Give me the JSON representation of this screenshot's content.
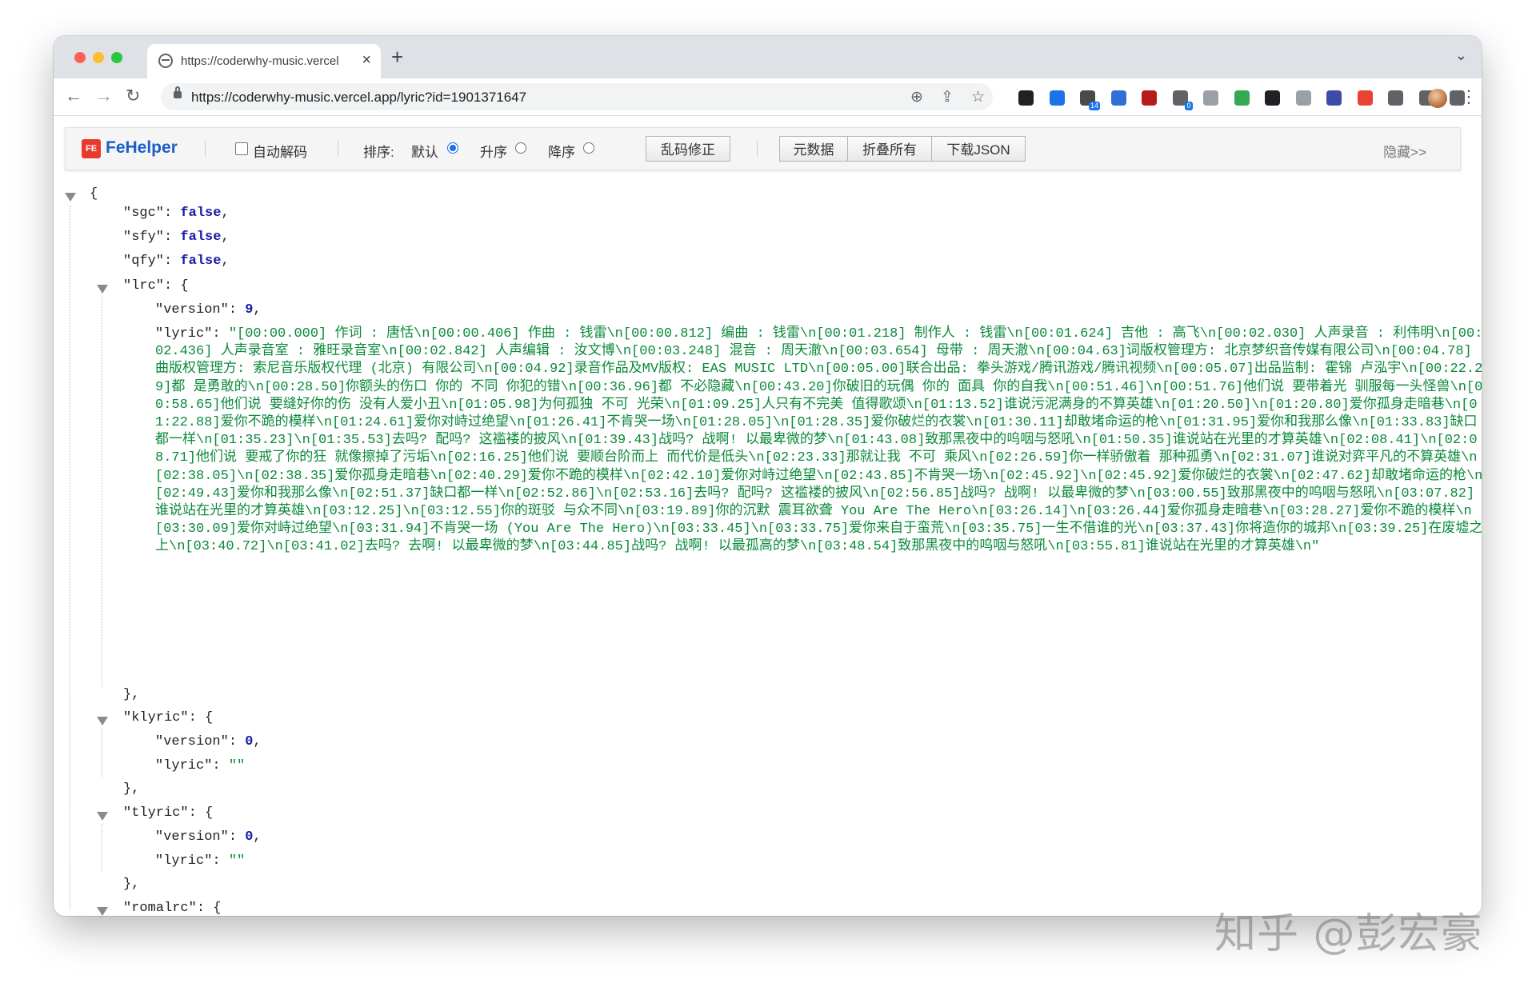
{
  "tab": {
    "title": "https://coderwhy-music.vercel",
    "close": "×",
    "new": "+",
    "menu": "⌄"
  },
  "toolbar": {
    "back": "←",
    "forward": "→",
    "reload": "↻",
    "url": "https://coderwhy-music.vercel.app/lyric?id=1901371647",
    "zoom_icon": "⊕",
    "share_icon": "⇪",
    "star_icon": "☆",
    "kebab": "⋮"
  },
  "extensions": [
    {
      "name": "ext-1",
      "color": "#202124",
      "badge": ""
    },
    {
      "name": "ext-2",
      "color": "#1a73e8",
      "badge": ""
    },
    {
      "name": "ext-3",
      "color": "#4a4a4a",
      "badge": "14"
    },
    {
      "name": "ext-4",
      "color": "#2f6fd6",
      "badge": ""
    },
    {
      "name": "ext-5",
      "color": "#b71c1c",
      "badge": ""
    },
    {
      "name": "ext-6",
      "color": "#5f6368",
      "badge": "0"
    },
    {
      "name": "ext-7",
      "color": "#9aa0a6",
      "badge": ""
    },
    {
      "name": "ext-8",
      "color": "#34a853",
      "badge": ""
    },
    {
      "name": "ext-9",
      "color": "#202124",
      "badge": ""
    },
    {
      "name": "ext-10",
      "color": "#9aa0a6",
      "badge": ""
    },
    {
      "name": "ext-11",
      "color": "#3c4aa8",
      "badge": ""
    },
    {
      "name": "ext-12",
      "color": "#ea4335",
      "badge": ""
    },
    {
      "name": "ext-13",
      "color": "#5f6368",
      "badge": ""
    },
    {
      "name": "ext-14",
      "color": "#5f6368",
      "badge": ""
    },
    {
      "name": "ext-15",
      "color": "#5f6368",
      "badge": ""
    }
  ],
  "fehelper": {
    "logo_badge": "FE",
    "logo_text": "FeHelper",
    "auto_decode": "自动解码",
    "sort_label": "排序:",
    "sort_default": "默认",
    "sort_asc": "升序",
    "sort_desc": "降序",
    "fix_garbled": "乱码修正",
    "metadata": "元数据",
    "collapse_all": "折叠所有",
    "download_json": "下载JSON",
    "hide": "隐藏>>"
  },
  "json": {
    "open_brace": "{",
    "sgc_key": "\"sgc\": ",
    "sgc_val": "false",
    "sfy_key": "\"sfy\": ",
    "sfy_val": "false",
    "qfy_key": "\"qfy\": ",
    "qfy_val": "false",
    "comma": ",",
    "lrc_key": "\"lrc\": {",
    "lrc_version_key": "\"version\": ",
    "lrc_version_val": "9",
    "lrc_lyric_key": "\"lyric\": ",
    "lrc_lyric_val": "\"[00:00.000] 作词 : 唐恬\\n[00:00.406] 作曲 : 钱雷\\n[00:00.812] 编曲 : 钱雷\\n[00:01.218] 制作人 : 钱雷\\n[00:01.624] 吉他 : 高飞\\n[00:02.030] 人声录音 : 利伟明\\n[00:02.436] 人声录音室 : 雅旺录音室\\n[00:02.842] 人声编辑 : 汝文博\\n[00:03.248] 混音 : 周天澈\\n[00:03.654] 母带 : 周天澈\\n[00:04.63]词版权管理方: 北京梦织音传媒有限公司\\n[00:04.78]曲版权管理方: 索尼音乐版权代理 (北京) 有限公司\\n[00:04.92]录音作品及MV版权: EAS MUSIC LTD\\n[00:05.00]联合出品: 拳头游戏/腾讯游戏/腾讯视频\\n[00:05.07]出品监制: 霍锦 卢泓宇\\n[00:22.29]都 是勇敢的\\n[00:28.50]你额头的伤口 你的 不同 你犯的错\\n[00:36.96]都 不必隐藏\\n[00:43.20]你破旧的玩偶 你的 面具 你的自我\\n[00:51.46]\\n[00:51.76]他们说 要带着光 驯服每一头怪兽\\n[00:58.65]他们说 要缝好你的伤 没有人爱小丑\\n[01:05.98]为何孤独 不可 光荣\\n[01:09.25]人只有不完美 值得歌颂\\n[01:13.52]谁说污泥满身的不算英雄\\n[01:20.50]\\n[01:20.80]爱你孤身走暗巷\\n[01:22.88]爱你不跪的模样\\n[01:24.61]爱你对峙过绝望\\n[01:26.41]不肯哭一场\\n[01:28.05]\\n[01:28.35]爱你破烂的衣裳\\n[01:30.11]却敢堵命运的枪\\n[01:31.95]爱你和我那么像\\n[01:33.83]缺口都一样\\n[01:35.23]\\n[01:35.53]去吗? 配吗? 这褴褛的披风\\n[01:39.43]战吗? 战啊! 以最卑微的梦\\n[01:43.08]致那黑夜中的呜咽与怒吼\\n[01:50.35]谁说站在光里的才算英雄\\n[02:08.41]\\n[02:08.71]他们说 要戒了你的狂 就像擦掉了污垢\\n[02:16.25]他们说 要顺台阶而上 而代价是低头\\n[02:23.33]那就让我 不可 乘风\\n[02:26.59]你一样骄傲着 那种孤勇\\n[02:31.07]谁说对弈平凡的不算英雄\\n[02:38.05]\\n[02:38.35]爱你孤身走暗巷\\n[02:40.29]爱你不跪的模样\\n[02:42.10]爱你对峙过绝望\\n[02:43.85]不肯哭一场\\n[02:45.92]\\n[02:45.92]爱你破烂的衣裳\\n[02:47.62]却敢堵命运的枪\\n[02:49.43]爱你和我那么像\\n[02:51.37]缺口都一样\\n[02:52.86]\\n[02:53.16]去吗? 配吗? 这褴褛的披风\\n[02:56.85]战吗? 战啊! 以最卑微的梦\\n[03:00.55]致那黑夜中的呜咽与怒吼\\n[03:07.82]谁说站在光里的才算英雄\\n[03:12.25]\\n[03:12.55]你的斑驳 与众不同\\n[03:19.89]你的沉默 震耳欲聋 You Are The Hero\\n[03:26.14]\\n[03:26.44]爱你孤身走暗巷\\n[03:28.27]爱你不跪的模样\\n[03:30.09]爱你对峙过绝望\\n[03:31.94]不肯哭一场 (You Are The Hero)\\n[03:33.45]\\n[03:33.75]爱你来自于蛮荒\\n[03:35.75]一生不借谁的光\\n[03:37.43]你将造你的城邦\\n[03:39.25]在废墟之上\\n[03:40.72]\\n[03:41.02]去吗? 去啊! 以最卑微的梦\\n[03:44.85]战吗? 战啊! 以最孤高的梦\\n[03:48.54]致那黑夜中的呜咽与怒吼\\n[03:55.81]谁说站在光里的才算英雄\\n\"",
    "close_obj": "},",
    "klyric_key": "\"klyric\": {",
    "klyric_version_key": "\"version\": ",
    "klyric_version_val": "0",
    "klyric_lyric_key": "\"lyric\": ",
    "klyric_lyric_val": "\"\"",
    "tlyric_key": "\"tlyric\": {",
    "tlyric_version_key": "\"version\": ",
    "tlyric_version_val": "0",
    "tlyric_lyric_key": "\"lyric\": ",
    "tlyric_lyric_val": "\"\"",
    "romalrc_key": "\"romalrc\": {"
  },
  "watermark": "知乎 @彭宏豪",
  "colors": {
    "string": "#0b8a3a",
    "literal": "#1a1aa6",
    "tab_strip": "#dee1e6",
    "fehelper_blue": "#1a5fc8"
  }
}
